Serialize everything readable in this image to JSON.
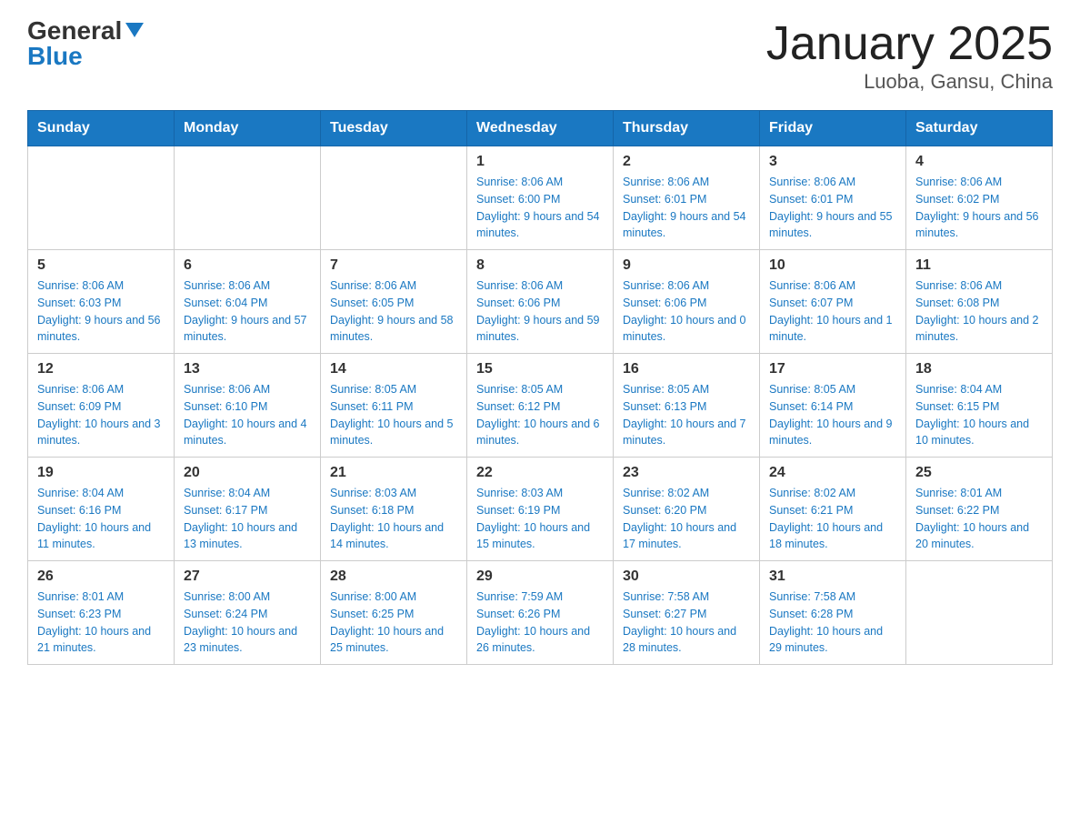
{
  "header": {
    "logo_general": "General",
    "logo_blue": "Blue",
    "title": "January 2025",
    "location": "Luoba, Gansu, China"
  },
  "days_of_week": [
    "Sunday",
    "Monday",
    "Tuesday",
    "Wednesday",
    "Thursday",
    "Friday",
    "Saturday"
  ],
  "weeks": [
    [
      {
        "day": "",
        "info": ""
      },
      {
        "day": "",
        "info": ""
      },
      {
        "day": "",
        "info": ""
      },
      {
        "day": "1",
        "info": "Sunrise: 8:06 AM\nSunset: 6:00 PM\nDaylight: 9 hours and 54 minutes."
      },
      {
        "day": "2",
        "info": "Sunrise: 8:06 AM\nSunset: 6:01 PM\nDaylight: 9 hours and 54 minutes."
      },
      {
        "day": "3",
        "info": "Sunrise: 8:06 AM\nSunset: 6:01 PM\nDaylight: 9 hours and 55 minutes."
      },
      {
        "day": "4",
        "info": "Sunrise: 8:06 AM\nSunset: 6:02 PM\nDaylight: 9 hours and 56 minutes."
      }
    ],
    [
      {
        "day": "5",
        "info": "Sunrise: 8:06 AM\nSunset: 6:03 PM\nDaylight: 9 hours and 56 minutes."
      },
      {
        "day": "6",
        "info": "Sunrise: 8:06 AM\nSunset: 6:04 PM\nDaylight: 9 hours and 57 minutes."
      },
      {
        "day": "7",
        "info": "Sunrise: 8:06 AM\nSunset: 6:05 PM\nDaylight: 9 hours and 58 minutes."
      },
      {
        "day": "8",
        "info": "Sunrise: 8:06 AM\nSunset: 6:06 PM\nDaylight: 9 hours and 59 minutes."
      },
      {
        "day": "9",
        "info": "Sunrise: 8:06 AM\nSunset: 6:06 PM\nDaylight: 10 hours and 0 minutes."
      },
      {
        "day": "10",
        "info": "Sunrise: 8:06 AM\nSunset: 6:07 PM\nDaylight: 10 hours and 1 minute."
      },
      {
        "day": "11",
        "info": "Sunrise: 8:06 AM\nSunset: 6:08 PM\nDaylight: 10 hours and 2 minutes."
      }
    ],
    [
      {
        "day": "12",
        "info": "Sunrise: 8:06 AM\nSunset: 6:09 PM\nDaylight: 10 hours and 3 minutes."
      },
      {
        "day": "13",
        "info": "Sunrise: 8:06 AM\nSunset: 6:10 PM\nDaylight: 10 hours and 4 minutes."
      },
      {
        "day": "14",
        "info": "Sunrise: 8:05 AM\nSunset: 6:11 PM\nDaylight: 10 hours and 5 minutes."
      },
      {
        "day": "15",
        "info": "Sunrise: 8:05 AM\nSunset: 6:12 PM\nDaylight: 10 hours and 6 minutes."
      },
      {
        "day": "16",
        "info": "Sunrise: 8:05 AM\nSunset: 6:13 PM\nDaylight: 10 hours and 7 minutes."
      },
      {
        "day": "17",
        "info": "Sunrise: 8:05 AM\nSunset: 6:14 PM\nDaylight: 10 hours and 9 minutes."
      },
      {
        "day": "18",
        "info": "Sunrise: 8:04 AM\nSunset: 6:15 PM\nDaylight: 10 hours and 10 minutes."
      }
    ],
    [
      {
        "day": "19",
        "info": "Sunrise: 8:04 AM\nSunset: 6:16 PM\nDaylight: 10 hours and 11 minutes."
      },
      {
        "day": "20",
        "info": "Sunrise: 8:04 AM\nSunset: 6:17 PM\nDaylight: 10 hours and 13 minutes."
      },
      {
        "day": "21",
        "info": "Sunrise: 8:03 AM\nSunset: 6:18 PM\nDaylight: 10 hours and 14 minutes."
      },
      {
        "day": "22",
        "info": "Sunrise: 8:03 AM\nSunset: 6:19 PM\nDaylight: 10 hours and 15 minutes."
      },
      {
        "day": "23",
        "info": "Sunrise: 8:02 AM\nSunset: 6:20 PM\nDaylight: 10 hours and 17 minutes."
      },
      {
        "day": "24",
        "info": "Sunrise: 8:02 AM\nSunset: 6:21 PM\nDaylight: 10 hours and 18 minutes."
      },
      {
        "day": "25",
        "info": "Sunrise: 8:01 AM\nSunset: 6:22 PM\nDaylight: 10 hours and 20 minutes."
      }
    ],
    [
      {
        "day": "26",
        "info": "Sunrise: 8:01 AM\nSunset: 6:23 PM\nDaylight: 10 hours and 21 minutes."
      },
      {
        "day": "27",
        "info": "Sunrise: 8:00 AM\nSunset: 6:24 PM\nDaylight: 10 hours and 23 minutes."
      },
      {
        "day": "28",
        "info": "Sunrise: 8:00 AM\nSunset: 6:25 PM\nDaylight: 10 hours and 25 minutes."
      },
      {
        "day": "29",
        "info": "Sunrise: 7:59 AM\nSunset: 6:26 PM\nDaylight: 10 hours and 26 minutes."
      },
      {
        "day": "30",
        "info": "Sunrise: 7:58 AM\nSunset: 6:27 PM\nDaylight: 10 hours and 28 minutes."
      },
      {
        "day": "31",
        "info": "Sunrise: 7:58 AM\nSunset: 6:28 PM\nDaylight: 10 hours and 29 minutes."
      },
      {
        "day": "",
        "info": ""
      }
    ]
  ]
}
